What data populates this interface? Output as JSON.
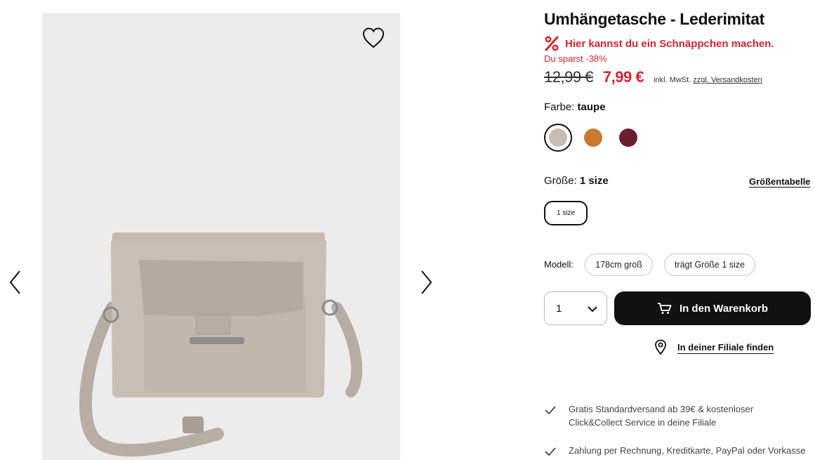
{
  "product": {
    "title": "Umhängetasche - Lederimitat",
    "deal_text": "Hier kannst du ein Schnäppchen machen.",
    "savings_text": "Du sparst -38%",
    "old_price": "12,99 €",
    "new_price": "7,99 €",
    "vat_text": "inkl. MwSt.",
    "shipping_link": "zzgl. Versandkosten"
  },
  "color": {
    "label": "Farbe:",
    "value": "taupe",
    "swatches": [
      {
        "name": "taupe",
        "hex": "#c7bdb4",
        "selected": true
      },
      {
        "name": "cognac",
        "hex": "#c97a2e",
        "selected": false
      },
      {
        "name": "bordeaux",
        "hex": "#6b1e2c",
        "selected": false
      }
    ]
  },
  "size": {
    "label": "Größe:",
    "value": "1 size",
    "chart_link": "Größentabelle",
    "options": [
      "1 size"
    ]
  },
  "model": {
    "label": "Modell:",
    "chips": [
      "178cm groß",
      "trägt Größe 1 size"
    ]
  },
  "cart": {
    "quantity": "1",
    "button_label": "In den Warenkorb"
  },
  "store": {
    "link": "In deiner Filiale finden"
  },
  "benefits": [
    "Gratis Standardversand ab 39€ & kostenloser Click&Collect Service in deine Filiale",
    "Zahlung per Rechnung, Kreditkarte, PayPal oder Vorkasse"
  ],
  "icons": {
    "prev": "chevron-left-icon",
    "next": "chevron-right-icon",
    "wishlist": "heart-icon",
    "deal": "percent-icon",
    "qty": "chevron-down-icon",
    "cart": "cart-icon",
    "store": "map-pin-icon",
    "benefit": "check-icon"
  },
  "colors": {
    "sale_red": "#d22630",
    "button_black": "#111111",
    "image_bg": "#ececec"
  }
}
